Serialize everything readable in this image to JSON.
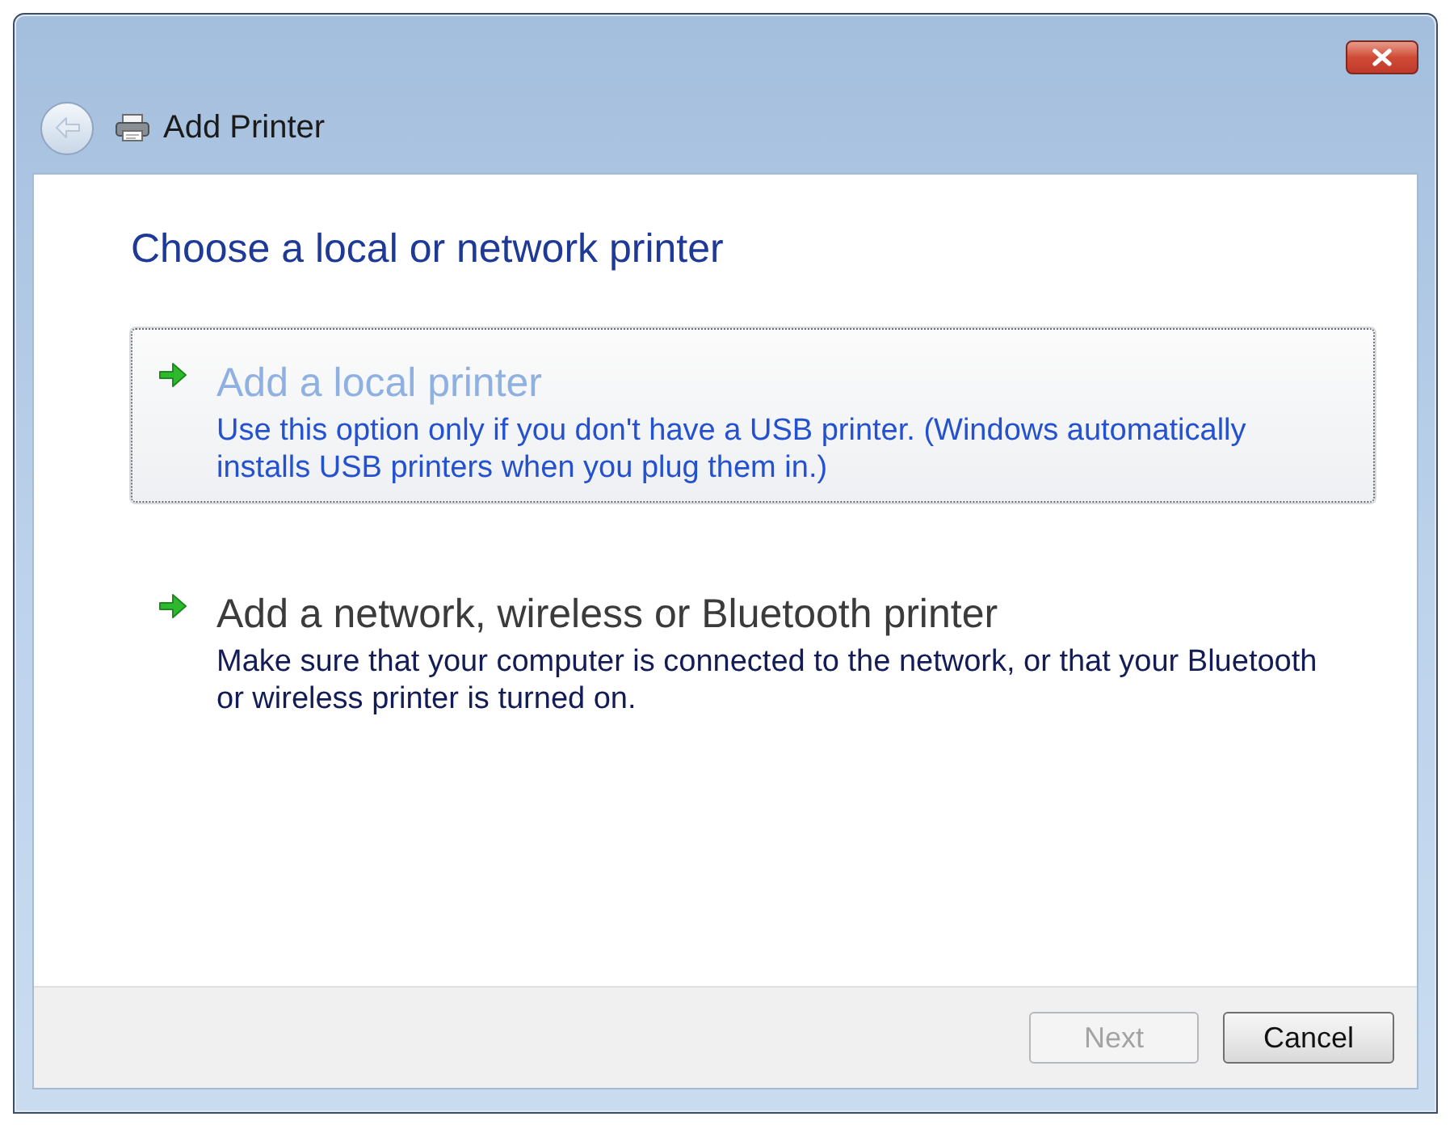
{
  "window": {
    "title": "Add Printer"
  },
  "heading": "Choose a local or network printer",
  "options": [
    {
      "title": "Add a local printer",
      "description": "Use this option only if you don't have a USB printer. (Windows automatically installs USB printers when you plug them in.)",
      "selected": true
    },
    {
      "title": "Add a network, wireless or Bluetooth printer",
      "description": "Make sure that your computer is connected to the network, or that your Bluetooth or wireless printer is turned on.",
      "selected": false
    }
  ],
  "buttons": [
    {
      "label": "Next",
      "disabled": true
    },
    {
      "label": "Cancel",
      "disabled": false
    }
  ]
}
